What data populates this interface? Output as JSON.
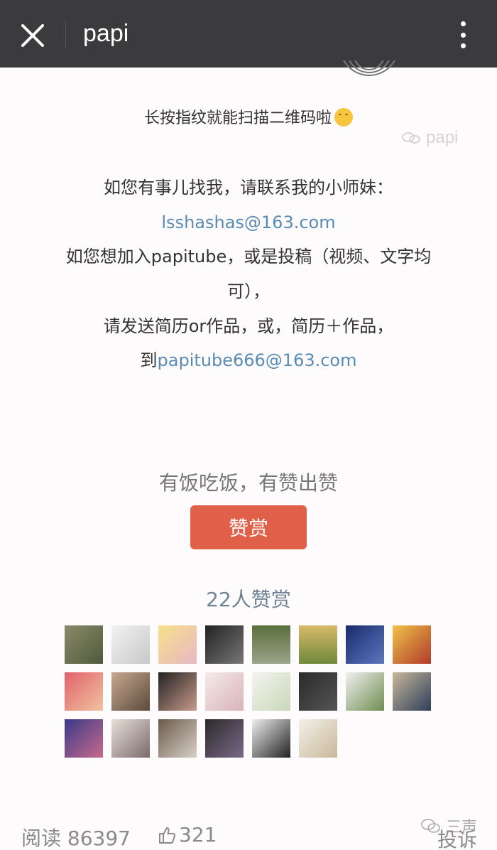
{
  "topbar": {
    "title": "papi",
    "close_icon": "close-icon",
    "menu_icon": "more-vertical-icon"
  },
  "article": {
    "scan_hint": "长按指纹就能扫描二维码啦",
    "scan_emoji": "smiling-emoji",
    "watermark": "papi",
    "contact_line": "如您有事儿找我，请联系我的小师妹：",
    "contact_email": "lsshashas@163.com",
    "join_line_1": "如您想加入papitube，或是投稿（视频、文字均",
    "join_line_2": "可），",
    "join_line_3": "请发送简历or作品，或，简历＋作品，",
    "join_to": "到",
    "join_email": "papitube666@163.com"
  },
  "reward": {
    "caption": "有饭吃饭，有赞出赞",
    "button_label": "赞赏",
    "count_label": "22人赞赏",
    "accent_color": "#e0604a",
    "avatars": [
      "avatar-1",
      "avatar-2",
      "avatar-3",
      "avatar-4",
      "avatar-5",
      "avatar-6",
      "avatar-7",
      "avatar-8",
      "avatar-9",
      "avatar-10",
      "avatar-11",
      "avatar-12",
      "avatar-13",
      "avatar-14",
      "avatar-15",
      "avatar-16",
      "avatar-17",
      "avatar-18",
      "avatar-19",
      "avatar-20",
      "avatar-21",
      "avatar-22"
    ]
  },
  "footer": {
    "read_label": "阅读",
    "read_count": "86397",
    "like_icon": "thumbs-up-icon",
    "like_count": "321",
    "watermark_text": "三声",
    "report_label": "投诉"
  }
}
